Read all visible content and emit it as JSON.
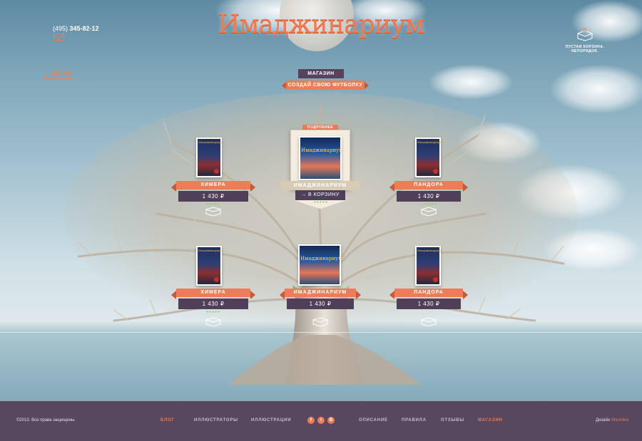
{
  "brand": {
    "logo_text": "Имаджинариум"
  },
  "header": {
    "phone_code": "(495)",
    "phone_number": "345-82-12",
    "back_link": "ИГРА",
    "cart_text_line1": "ПУСТАЯ КОРЗИНА.",
    "cart_text_line2": "НЕПОРЯДОК."
  },
  "shop": {
    "tab_shop": "МАГАЗИН",
    "tab_tshirt": "СОЗДАЙ СВОЮ ФУТБОЛКУ"
  },
  "featured": {
    "more_label": "ПОДРОБНЕЕ",
    "name": "ИМАДЖИНАРИУМ",
    "cart_button": "В КОРЗИНУ",
    "cover_title": "Имаджинариум"
  },
  "products": [
    {
      "name": "ХИМЕРА",
      "price": "1 430 ₽",
      "cover_title": "Имаджинариум"
    },
    {
      "name": "ПАНДОРА",
      "price": "1 430 ₽",
      "cover_title": "Имаджинариум"
    },
    {
      "name": "ХИМЕРА",
      "price": "1 430 ₽",
      "cover_title": "Имаджинариум"
    },
    {
      "name": "ИМАДЖИНАРИУМ",
      "price": "1 430 ₽",
      "cover_title": "Имаджинариум"
    },
    {
      "name": "ПАНДОРА",
      "price": "1 430 ₽",
      "cover_title": "Имаджинариум"
    }
  ],
  "footer": {
    "copyright": "©2013. Все права защищены.",
    "nav": [
      "БЛОГ",
      "ИЛЛЮСТРАТОРЫ",
      "ИЛЛЮСТРАЦИИ",
      "ОПИСАНИЕ",
      "ПРАВИЛА",
      "ОТЗЫВЫ",
      "МАГАЗИН"
    ],
    "social": [
      "f",
      "t",
      "B"
    ],
    "design_label": "Дизайн",
    "design_by": "Shumilov"
  },
  "colors": {
    "accent": "#ee7d57",
    "dark": "#4f3f59",
    "footer": "#57475f"
  }
}
